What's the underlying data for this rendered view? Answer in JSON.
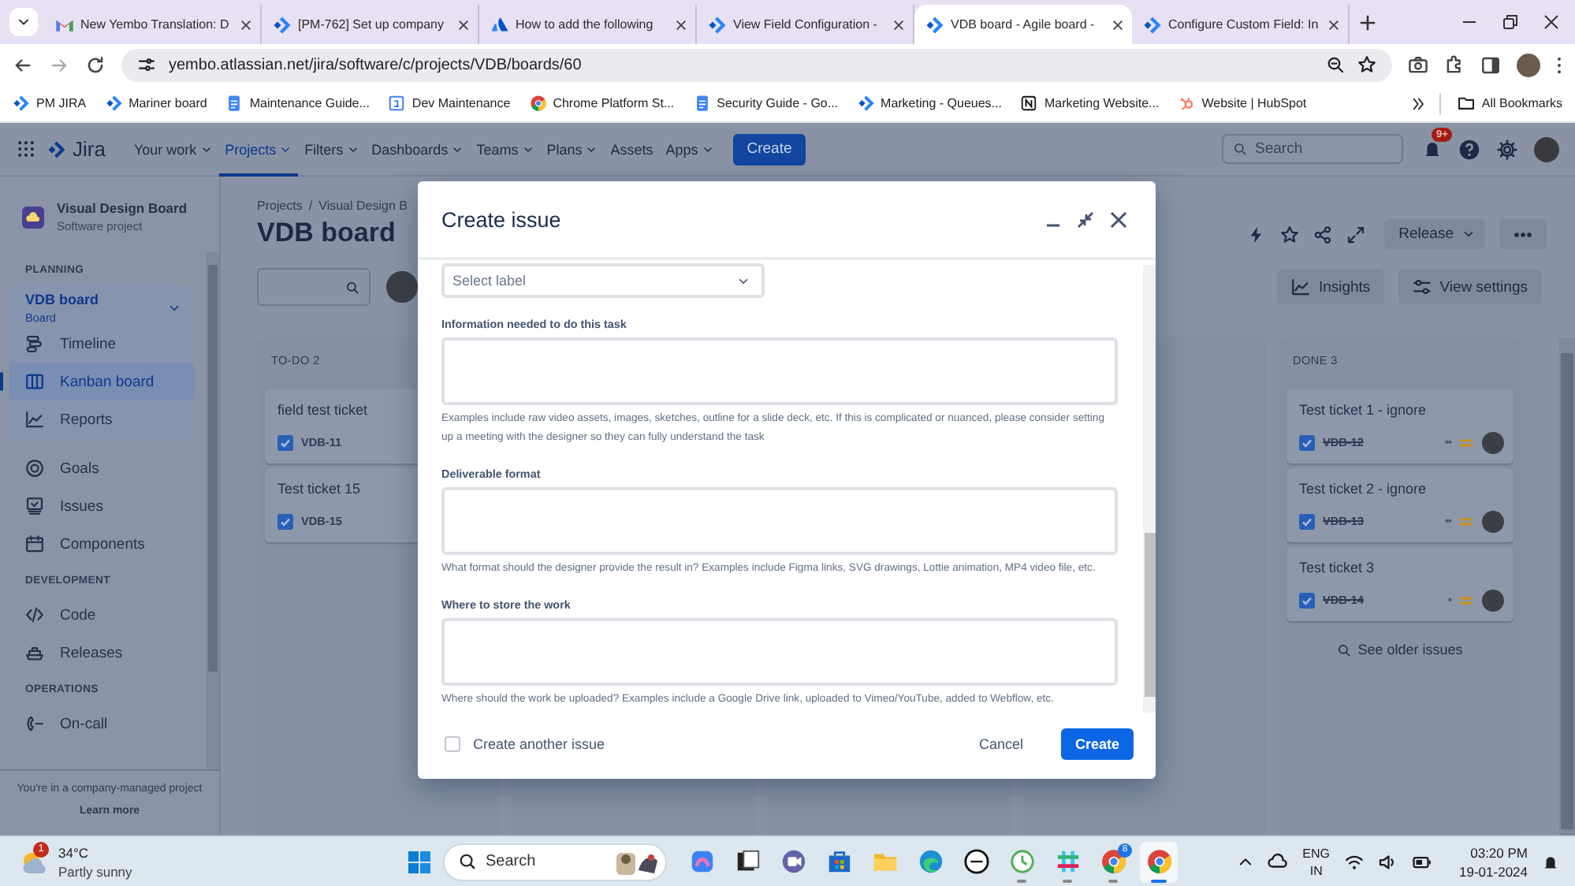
{
  "browser": {
    "tabs": [
      {
        "title": "New Yembo Translation: D",
        "selected": false
      },
      {
        "title": "[PM-762] Set up company",
        "selected": false
      },
      {
        "title": "How to add the following",
        "selected": false
      },
      {
        "title": "View Field Configuration -",
        "selected": false
      },
      {
        "title": "VDB board - Agile board -",
        "selected": true
      },
      {
        "title": "Configure Custom Field: In",
        "selected": false
      }
    ],
    "url": "yembo.atlassian.net/jira/software/c/projects/VDB/boards/60",
    "bookmarks": [
      {
        "label": "PM JIRA"
      },
      {
        "label": "Mariner board"
      },
      {
        "label": "Maintenance Guide..."
      },
      {
        "label": "Dev Maintenance"
      },
      {
        "label": "Chrome Platform St..."
      },
      {
        "label": "Security Guide - Go..."
      },
      {
        "label": "Marketing - Queues..."
      },
      {
        "label": "Marketing Website..."
      },
      {
        "label": "Website | HubSpot"
      }
    ],
    "all_bookmarks": "All Bookmarks"
  },
  "jira": {
    "product": "Jira",
    "nav": [
      {
        "label": "Your work",
        "dropdown": true,
        "selected": false
      },
      {
        "label": "Projects",
        "dropdown": true,
        "selected": true
      },
      {
        "label": "Filters",
        "dropdown": true,
        "selected": false
      },
      {
        "label": "Dashboards",
        "dropdown": true,
        "selected": false
      },
      {
        "label": "Teams",
        "dropdown": true,
        "selected": false
      },
      {
        "label": "Plans",
        "dropdown": true,
        "selected": false
      },
      {
        "label": "Assets",
        "dropdown": false,
        "selected": false
      },
      {
        "label": "Apps",
        "dropdown": true,
        "selected": false
      }
    ],
    "create": "Create",
    "search_placeholder": "Search",
    "notification_badge": "9+"
  },
  "sidebar": {
    "project_name": "Visual Design Board",
    "project_type": "Software project",
    "sections": [
      {
        "heading": "PLANNING",
        "items": [
          {
            "label": "VDB board",
            "sublabel": "Board",
            "expanded": true,
            "selected": false,
            "children": [
              {
                "label": "Timeline",
                "selected": false
              },
              {
                "label": "Kanban board",
                "selected": true
              },
              {
                "label": "Reports",
                "selected": false
              }
            ]
          },
          {
            "label": "Goals",
            "selected": false
          },
          {
            "label": "Issues",
            "selected": false
          },
          {
            "label": "Components",
            "selected": false
          }
        ]
      },
      {
        "heading": "DEVELOPMENT",
        "items": [
          {
            "label": "Code",
            "selected": false
          },
          {
            "label": "Releases",
            "selected": false
          }
        ]
      },
      {
        "heading": "OPERATIONS",
        "items": [
          {
            "label": "On-call",
            "selected": false
          }
        ]
      }
    ],
    "footer_note": "You're in a company-managed project",
    "footer_link": "Learn more"
  },
  "board": {
    "breadcrumbs": [
      "Projects",
      "Visual Design B"
    ],
    "breadcrumb_separator": "/",
    "title": "VDB board",
    "release_button": "Release",
    "insights_button": "Insights",
    "view_settings_button": "View settings",
    "columns": [
      {
        "title": "TO-DO 2",
        "cards": [
          {
            "title": "field test ticket",
            "key": "VDB-11",
            "done": false
          },
          {
            "title": "Test ticket 15",
            "key": "VDB-15",
            "done": false
          }
        ]
      },
      {
        "title": "DONE 3",
        "cards": [
          {
            "title": "Test ticket 1 - ignore",
            "key": "VDB-12",
            "done": true,
            "estimate": "••"
          },
          {
            "title": "Test ticket 2 - ignore",
            "key": "VDB-13",
            "done": true,
            "estimate": "••"
          },
          {
            "title": "Test ticket 3",
            "key": "VDB-14",
            "done": true,
            "estimate": "•"
          }
        ],
        "footer": "See older issues"
      }
    ]
  },
  "modal": {
    "title": "Create issue",
    "fields": [
      {
        "kind": "select",
        "placeholder": "Select label"
      },
      {
        "kind": "textarea",
        "label": "Information needed to do this task",
        "help": "Examples include raw video assets, images, sketches, outline for a slide deck, etc. If this is complicated or nuanced, please consider setting up a meeting with the designer so they can fully understand the task"
      },
      {
        "kind": "textarea",
        "label": "Deliverable format",
        "help": "What format should the designer provide the result in? Examples include Figma links, SVG drawings, Lottie animation, MP4 video file, etc."
      },
      {
        "kind": "textarea",
        "label": "Where to store the work",
        "help": "Where should the work be uploaded? Examples include a Google Drive link, uploaded to Vimeo/YouTube, added to Webflow, etc."
      }
    ],
    "create_another": {
      "label": "Create another issue",
      "checked": false
    },
    "cancel": "Cancel",
    "submit": "Create"
  },
  "taskbar": {
    "weather": {
      "temperature": "34°C",
      "condition": "Partly sunny",
      "badge": "1"
    },
    "search_placeholder": "Search",
    "app_badge": "8",
    "apps": [
      {
        "running": false,
        "active": false
      },
      {
        "running": false,
        "active": false
      },
      {
        "running": false,
        "active": false
      },
      {
        "running": false,
        "active": false
      },
      {
        "running": false,
        "active": false
      },
      {
        "running": false,
        "active": false
      },
      {
        "running": false,
        "active": false
      },
      {
        "running": true,
        "active": false
      },
      {
        "running": true,
        "active": false
      },
      {
        "running": true,
        "active": false
      },
      {
        "running": true,
        "active": true
      }
    ],
    "language": "ENG",
    "region": "IN",
    "time": "03:20 PM",
    "date": "19-01-2024"
  }
}
